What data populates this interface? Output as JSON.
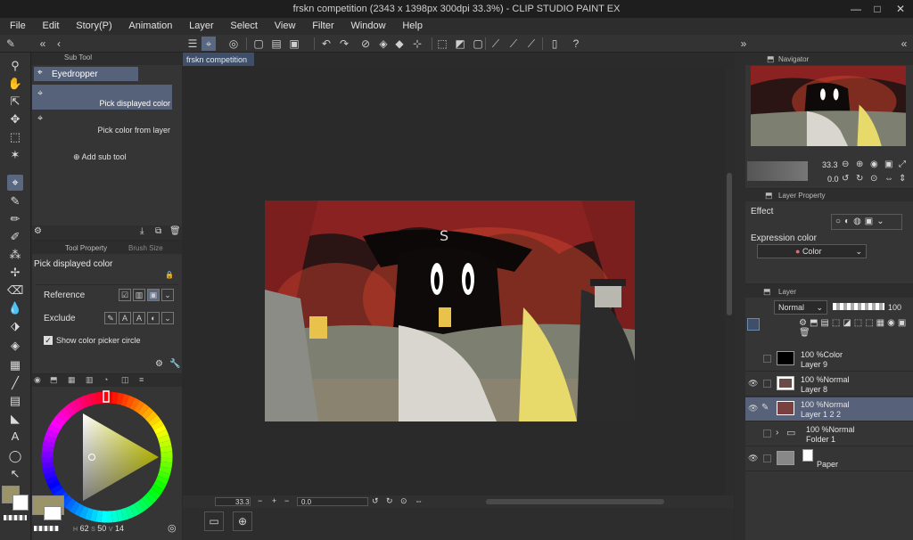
{
  "window": {
    "title": "frskn competition (2343 x 1398px 300dpi 33.3%) - CLIP STUDIO PAINT EX",
    "minimize": "—",
    "maximize": "□",
    "close": "✕"
  },
  "menu": [
    "File",
    "Edit",
    "Story(P)",
    "Animation",
    "Layer",
    "Select",
    "View",
    "Filter",
    "Window",
    "Help"
  ],
  "sub_tool": {
    "header": "Sub Tool",
    "group": "Eyedropper",
    "items": [
      "Pick displayed color",
      "Pick color from layer"
    ],
    "add_label": "Add sub tool"
  },
  "tool_property": {
    "tab1": "Tool Property",
    "tab2": "Brush Size",
    "title": "Pick displayed color",
    "reference_label": "Reference",
    "exclude_label": "Exclude",
    "show_circle_label": "Show color picker circle"
  },
  "document": {
    "tab": "frskn competition"
  },
  "canvas_status": {
    "zoom": "33.3",
    "angle": "0.0"
  },
  "color": {
    "main": "#9b9468",
    "sub": "#ffffff",
    "h": "62",
    "s": "50",
    "v": "14",
    "h_label": "H",
    "s_label": "S",
    "v_label": "V"
  },
  "navigator": {
    "title": "Navigator",
    "zoom": "33.3",
    "angle": "0.0"
  },
  "layer_property": {
    "title": "Layer Property",
    "effect_label": "Effect",
    "expression_label": "Expression color",
    "expression_value": "Color"
  },
  "layer_panel": {
    "title": "Layer",
    "blend_mode": "Normal",
    "opacity": "100",
    "layers": [
      {
        "percent": "100 %",
        "mode": "Color",
        "name": "Layer 9",
        "thumb": "#000000",
        "visible": false,
        "selected": false
      },
      {
        "percent": "100 %",
        "mode": "Normal",
        "name": "Layer 8",
        "thumb": "#6a4a48",
        "visible": true,
        "selected": false
      },
      {
        "percent": "100 %",
        "mode": "Normal",
        "name": "Layer 1 2 2",
        "thumb": "#7a4040",
        "visible": true,
        "selected": true
      },
      {
        "percent": "100 %",
        "mode": "Normal",
        "name": "Folder 1",
        "thumb": "",
        "visible": false,
        "selected": false
      },
      {
        "percent": "",
        "mode": "",
        "name": "Paper",
        "thumb": "#ffffff",
        "visible": true,
        "selected": false
      }
    ]
  }
}
